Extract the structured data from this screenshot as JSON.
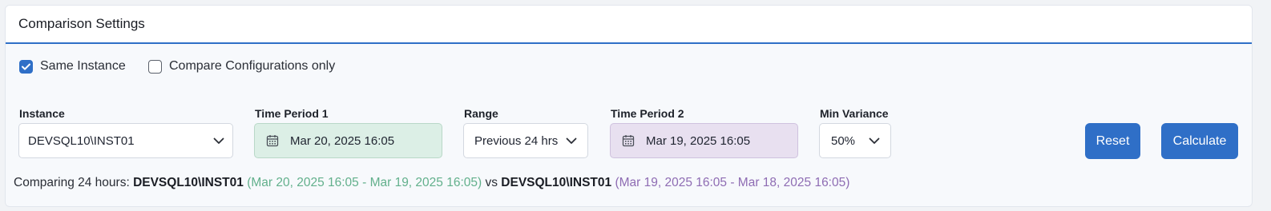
{
  "panel": {
    "title": "Comparison Settings"
  },
  "options": {
    "same_instance": {
      "label": "Same Instance",
      "checked": true
    },
    "compare_configs": {
      "label": "Compare Configurations only",
      "checked": false
    }
  },
  "fields": {
    "instance": {
      "label": "Instance",
      "value": "DEVSQL10\\INST01"
    },
    "time_period_1": {
      "label": "Time Period 1",
      "value": "Mar 20, 2025 16:05"
    },
    "range": {
      "label": "Range",
      "value": "Previous 24 hrs"
    },
    "time_period_2": {
      "label": "Time Period 2",
      "value": "Mar 19, 2025 16:05"
    },
    "min_variance": {
      "label": "Min Variance",
      "value": "50%"
    }
  },
  "buttons": {
    "reset": "Reset",
    "calculate": "Calculate"
  },
  "summary": {
    "prefix": "Comparing 24 hours: ",
    "instance_1": "DEVSQL10\\INST01",
    "range_1": "(Mar 20, 2025 16:05 - Mar 19, 2025 16:05)",
    "vs": " vs ",
    "instance_2": "DEVSQL10\\INST01",
    "range_2": "(Mar 19, 2025 16:05 - Mar 18, 2025 16:05)"
  },
  "colors": {
    "accent": "#2f6fc7",
    "period_1": "#62b08c",
    "period_1_bg": "#dcefe6",
    "period_2": "#8e6cb3",
    "period_2_bg": "#e8e0f0"
  },
  "icons": {
    "checkbox_checked": "check-icon",
    "date": "calendar-icon",
    "dropdown": "chevron-down-icon"
  }
}
